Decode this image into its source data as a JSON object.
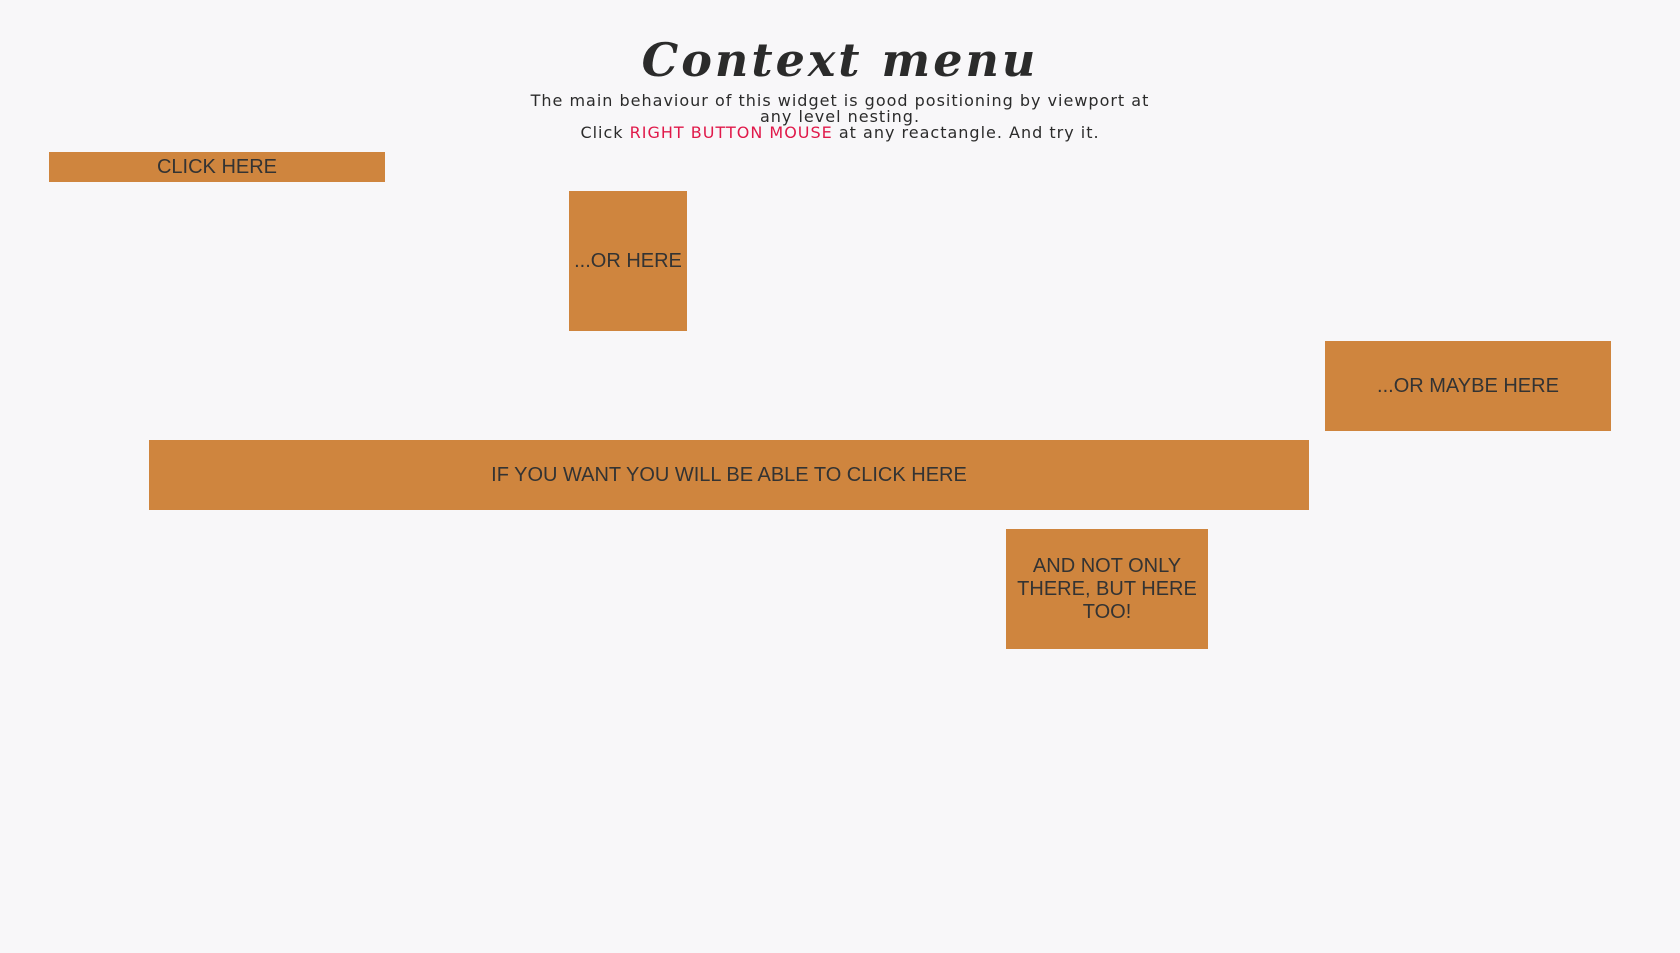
{
  "header": {
    "title": "Context menu",
    "description_line1": "The main behaviour of this widget is good positioning by viewport at any level nesting.",
    "description_line2_prefix": "Click ",
    "description_line2_highlight": "RIGHT BUTTON MOUSE",
    "description_line2_suffix": " at any reactangle. And try it."
  },
  "boxes": [
    {
      "label": "CLICK HERE"
    },
    {
      "label": "...OR HERE"
    },
    {
      "label": "...OR MAYBE HERE"
    },
    {
      "label": "IF YOU WANT YOU WILL BE ABLE TO CLICK HERE"
    },
    {
      "label": "AND NOT ONLY THERE, BUT HERE TOO!"
    }
  ],
  "colors": {
    "background": "#f8f7f9",
    "box": "#cf853e",
    "highlight": "#e0194a",
    "text": "#2b2b2b"
  }
}
